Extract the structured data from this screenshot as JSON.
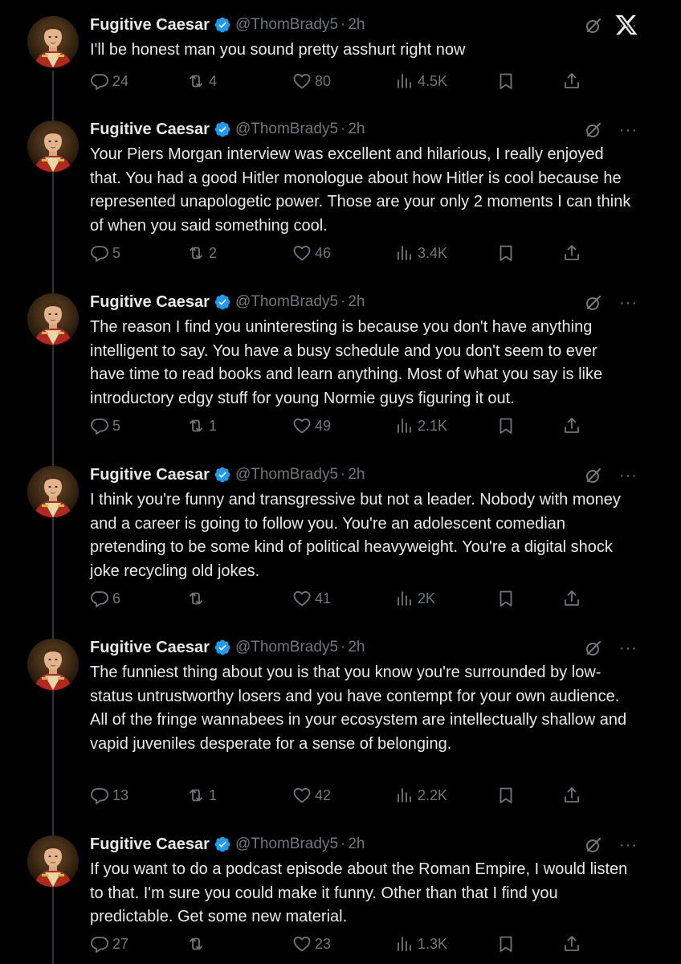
{
  "tweets": [
    {
      "name": "Fugitive Caesar",
      "handle": "@ThomBrady5",
      "time": "2h",
      "text": "I'll be honest man you sound pretty asshurt right now",
      "replies": "24",
      "retweets": "4",
      "likes": "80",
      "views": "4.5K"
    },
    {
      "name": "Fugitive Caesar",
      "handle": "@ThomBrady5",
      "time": "2h",
      "text": "Your Piers Morgan interview was excellent and hilarious, I really enjoyed that. You had a good Hitler monologue about how Hitler is cool because he represented unapologetic power. Those are your only 2 moments I can think of when you said something cool.",
      "replies": "5",
      "retweets": "2",
      "likes": "46",
      "views": "3.4K"
    },
    {
      "name": "Fugitive Caesar",
      "handle": "@ThomBrady5",
      "time": "2h",
      "text": "The reason I find you uninteresting is because you don't have anything intelligent to say. You have a busy schedule and you don't seem to ever have time to read books and learn anything. Most of what you say is like introductory edgy stuff for young Normie guys figuring it out.",
      "replies": "5",
      "retweets": "1",
      "likes": "49",
      "views": "2.1K"
    },
    {
      "name": "Fugitive Caesar",
      "handle": "@ThomBrady5",
      "time": "2h",
      "text": "I think you're funny and transgressive but not a leader. Nobody with money and a career is going to follow you. You're an adolescent comedian pretending to be some kind of political heavyweight. You're a digital shock joke recycling old jokes.",
      "replies": "6",
      "retweets": "",
      "likes": "41",
      "views": "2K"
    },
    {
      "name": "Fugitive Caesar",
      "handle": "@ThomBrady5",
      "time": "2h",
      "text": "The funniest thing about you is that you know you're surrounded by low-status untrustworthy losers and you have contempt for your own audience. All of the fringe wannabees in your ecosystem are intellectually shallow and vapid juveniles desperate for a sense of belonging.",
      "replies": "13",
      "retweets": "1",
      "likes": "42",
      "views": "2.2K"
    },
    {
      "name": "Fugitive Caesar",
      "handle": "@ThomBrady5",
      "time": "2h",
      "text": "If you want to do a podcast episode about the Roman Empire, I would listen to that. I'm sure you could make it funny. Other than that I find you predictable. Get some new material.",
      "replies": "27",
      "retweets": "",
      "likes": "23",
      "views": "1.3K"
    }
  ],
  "separator": "·",
  "colors": {
    "background": "#000000",
    "text": "#e7e9ea",
    "muted": "#71767b",
    "verified": "#1d9bf0"
  },
  "icons": {
    "reply": "reply-icon",
    "retweet": "retweet-icon",
    "like": "heart-icon",
    "views": "views-icon",
    "bookmark": "bookmark-icon",
    "share": "share-icon",
    "grok": "grok-icon",
    "more": "more-icon",
    "logo": "x-logo-icon"
  }
}
